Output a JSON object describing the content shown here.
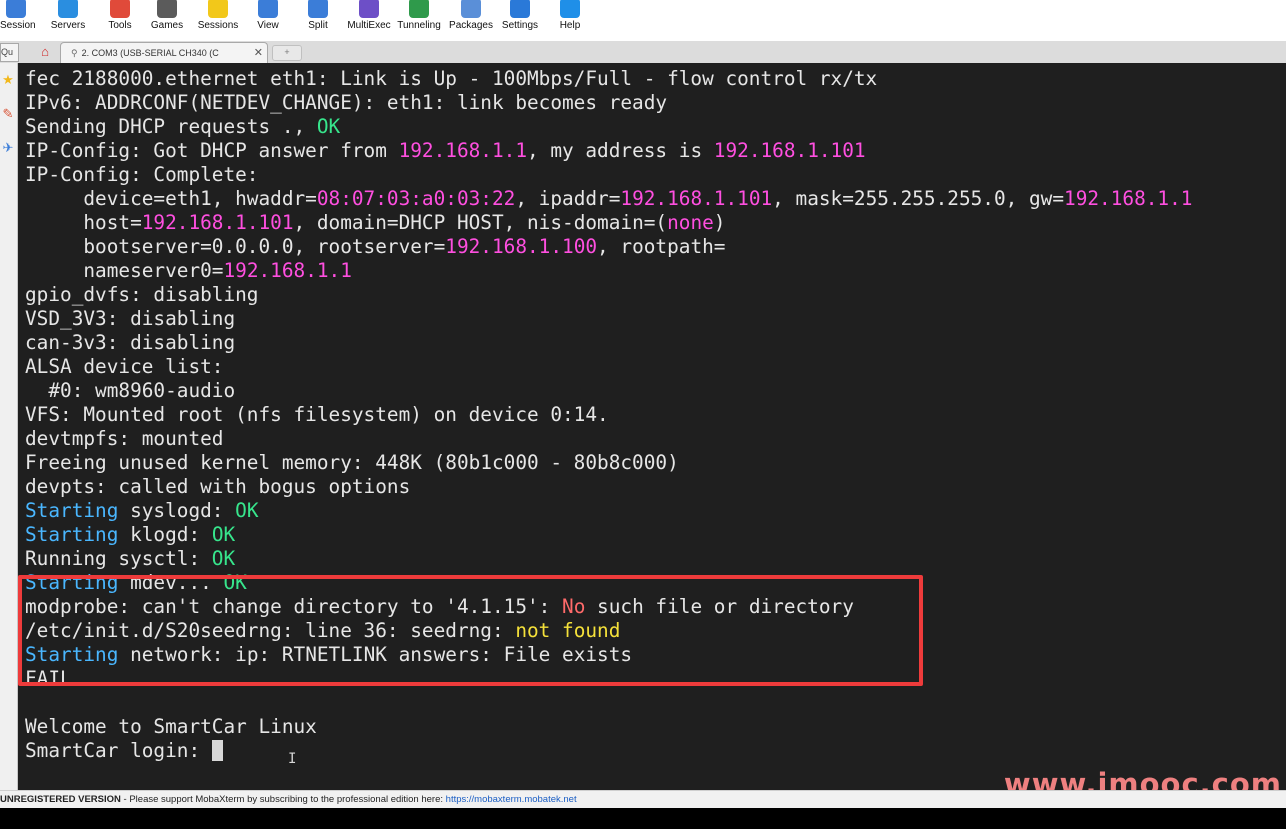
{
  "toolbar": {
    "buttons": [
      {
        "label": "Session",
        "icon": "session-icon",
        "color": "#3b7dd8"
      },
      {
        "label": "Servers",
        "icon": "servers-icon",
        "color": "#2a8ee0"
      },
      {
        "label": "Tools",
        "icon": "tools-icon",
        "color": "#e04a3a"
      },
      {
        "label": "Games",
        "icon": "games-icon",
        "color": "#5b5b5b"
      },
      {
        "label": "Sessions",
        "icon": "star-icon",
        "color": "#f2c81a"
      },
      {
        "label": "View",
        "icon": "view-icon",
        "color": "#3b7dd8"
      },
      {
        "label": "Split",
        "icon": "split-icon",
        "color": "#3b7dd8"
      },
      {
        "label": "MultiExec",
        "icon": "multiexec-icon",
        "color": "#6d4fc7"
      },
      {
        "label": "Tunneling",
        "icon": "tunneling-icon",
        "color": "#2f9a4b"
      },
      {
        "label": "Packages",
        "icon": "packages-icon",
        "color": "#5a8fd8"
      },
      {
        "label": "Settings",
        "icon": "gear-icon",
        "color": "#2a79d8"
      },
      {
        "label": "Help",
        "icon": "help-icon",
        "color": "#1f8fe8"
      }
    ]
  },
  "tabs": {
    "quick_connect": "Qu",
    "active_tab": "2. COM3  (USB-SERIAL CH340 (C",
    "close": "✕",
    "new_tab": "+"
  },
  "terminal": {
    "lines": [
      [
        {
          "t": "fec 2188000.ethernet eth1: Link is Up - 100Mbps/Full - flow control rx/tx"
        }
      ],
      [
        {
          "t": "IPv6: ADDRCONF(NETDEV_CHANGE): eth1: link becomes ready"
        }
      ],
      [
        {
          "t": "Sending DHCP requests ., "
        },
        {
          "t": "OK",
          "c": "gr"
        }
      ],
      [
        {
          "t": "IP-Config: Got DHCP answer from "
        },
        {
          "t": "192.168.1.1",
          "c": "pk"
        },
        {
          "t": ", my address is "
        },
        {
          "t": "192.168.1.101",
          "c": "pk"
        }
      ],
      [
        {
          "t": "IP-Config: Complete:"
        }
      ],
      [
        {
          "t": "     device=eth1, hwaddr="
        },
        {
          "t": "08:07:03:a0:03:22",
          "c": "pk"
        },
        {
          "t": ", ipaddr="
        },
        {
          "t": "192.168.1.101",
          "c": "pk"
        },
        {
          "t": ", mask=255.255.255.0, gw="
        },
        {
          "t": "192.168.1.1",
          "c": "pk"
        }
      ],
      [
        {
          "t": "     host="
        },
        {
          "t": "192.168.1.101",
          "c": "pk"
        },
        {
          "t": ", domain=DHCP HOST, nis-domain=("
        },
        {
          "t": "none",
          "c": "pk"
        },
        {
          "t": ")"
        }
      ],
      [
        {
          "t": "     bootserver=0.0.0.0, rootserver="
        },
        {
          "t": "192.168.1.100",
          "c": "pk"
        },
        {
          "t": ", rootpath="
        }
      ],
      [
        {
          "t": "     nameserver0="
        },
        {
          "t": "192.168.1.1",
          "c": "pk"
        }
      ],
      [
        {
          "t": "gpio_dvfs: disabling"
        }
      ],
      [
        {
          "t": "VSD_3V3: disabling"
        }
      ],
      [
        {
          "t": "can-3v3: disabling"
        }
      ],
      [
        {
          "t": "ALSA device list:"
        }
      ],
      [
        {
          "t": "  #0: wm8960-audio"
        }
      ],
      [
        {
          "t": "VFS: Mounted root (nfs filesystem) on device 0:14."
        }
      ],
      [
        {
          "t": "devtmpfs: mounted"
        }
      ],
      [
        {
          "t": "Freeing unused kernel memory: 448K (80b1c000 - 80b8c000)"
        }
      ],
      [
        {
          "t": "devpts: called with bogus options"
        }
      ],
      [
        {
          "t": "Starting",
          "c": "cy"
        },
        {
          "t": " syslogd: "
        },
        {
          "t": "OK",
          "c": "gr"
        }
      ],
      [
        {
          "t": "Starting",
          "c": "cy"
        },
        {
          "t": " klogd: "
        },
        {
          "t": "OK",
          "c": "gr"
        }
      ],
      [
        {
          "t": "Running sysctl: "
        },
        {
          "t": "OK",
          "c": "gr"
        }
      ],
      [
        {
          "t": "Starting",
          "c": "cy"
        },
        {
          "t": " mdev... "
        },
        {
          "t": "OK",
          "c": "gr"
        }
      ],
      [
        {
          "t": "modprobe: can't change directory to '4.1.15': "
        },
        {
          "t": "No",
          "c": "rd"
        },
        {
          "t": " such file or directory"
        }
      ],
      [
        {
          "t": "/etc/init.d/S20seedrng: line 36: seedrng: "
        },
        {
          "t": "not found",
          "c": "yl"
        }
      ],
      [
        {
          "t": "Starting",
          "c": "cy"
        },
        {
          "t": " network: ip: RTNETLINK answers: File exists"
        }
      ],
      [
        {
          "t": "FAIL"
        }
      ],
      [
        {
          "t": ""
        }
      ],
      [
        {
          "t": "Welcome to SmartCar Linux"
        }
      ],
      [
        {
          "t": "SmartCar login: "
        }
      ]
    ],
    "watermark": "www.imooc.com"
  },
  "colors": {
    "terminal_bg": "#1f1f1f",
    "terminal_fg": "#e6e6e6",
    "ip_magenta": "#ff4fe0",
    "ok_green": "#37e58c",
    "starting_blue": "#4ab7ff",
    "highlight_red": "#ee3b3b"
  },
  "status": {
    "version": "UNREGISTERED VERSION",
    "message": "  -  Please support MobaXterm by subscribing to the professional edition here:  ",
    "link": "https://mobaxterm.mobatek.net"
  }
}
